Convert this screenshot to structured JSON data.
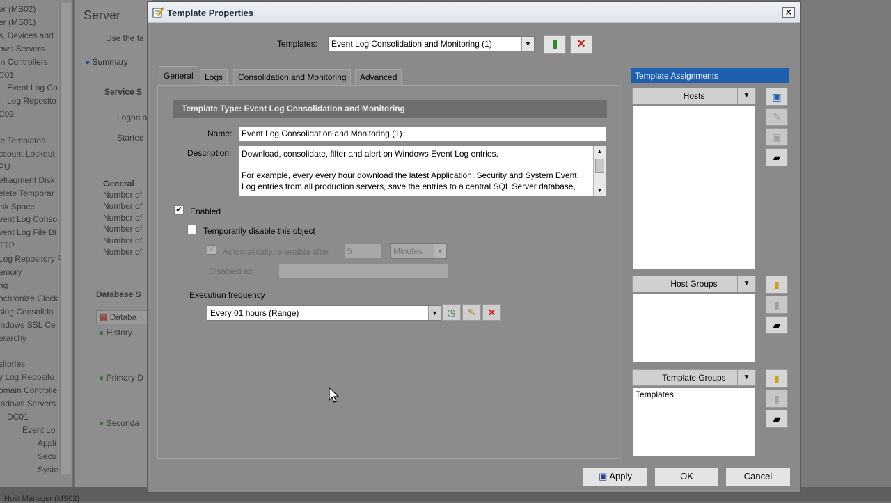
{
  "background": {
    "tree_items": [
      "er (MS02)",
      "er (MS01)",
      "s, Devices and",
      "ows Servers",
      "in Controllers",
      "C01",
      "Event Log Co",
      "Log Reposito",
      "C02",
      "",
      "le Templates",
      "ccount Lockout",
      "PU",
      "efragment Disk",
      "elete Temporar",
      "isk Space",
      "vent Log Conso",
      "vent Log File Bi",
      "TTP",
      "Log Repository F",
      "emory",
      "ng",
      "nchronize Clock",
      "slog Consolida",
      "indows SSL Ce",
      "erarchy",
      "",
      "sitories",
      "y Log Reposito",
      "omain Controlle",
      "indows Servers",
      "DC01",
      "Event Lo",
      "Appli",
      "Secu",
      "Syste"
    ],
    "main_title": "Server",
    "main_desc": "Use the ta",
    "main_tab": "Summary",
    "service_label": "Service S",
    "logon": "Logon a",
    "started": "Started",
    "general": "General",
    "number_of": [
      "Number of",
      "Number of",
      "Number of",
      "Number of",
      "Number of",
      "Number of"
    ],
    "database_label": "Database S",
    "db_column": "Databa",
    "db_rows": [
      "History",
      "Primary D",
      "Seconda"
    ],
    "bottom_text": "Host Manager (MS02)"
  },
  "dialog": {
    "title": "Template Properties",
    "templates_label": "Templates:",
    "templates_value": "Event Log Consolidation and Monitoring (1)",
    "tabs": [
      {
        "label": "General",
        "active": true
      },
      {
        "label": "Logs",
        "active": false
      },
      {
        "label": "Consolidation and Monitoring",
        "active": false
      },
      {
        "label": "Advanced",
        "active": false
      }
    ],
    "template_type_header": "Template Type: Event Log Consolidation and Monitoring",
    "name_label": "Name:",
    "name_value": "Event Log Consolidation and Monitoring (1)",
    "description_label": "Description:",
    "description_line1": "Download, consolidate, filter and alert on Windows Event Log entries.",
    "description_line2": "For example, every every hour download the latest Application, Security and System Event Log entries from all production servers, save the entries to a central SQL Server database,",
    "enabled_label": "Enabled",
    "enabled_checked": true,
    "temp_disable_label": "Temporarily disable this object",
    "temp_disable_checked": false,
    "auto_reenable_label": "Automatically re-enable after",
    "auto_reenable_checked": true,
    "reenable_value": "5",
    "reenable_unit": "Minutes",
    "disabled_at_label": "Disabled at:",
    "disabled_at_value": "",
    "exec_freq_label": "Execution frequency",
    "exec_freq_value": "Every 01 hours (Range)",
    "assignments_header": "Template Assignments",
    "hosts_label": "Hosts",
    "host_groups_label": "Host Groups",
    "template_groups_label": "Template Groups",
    "template_groups_items": [
      "Templates"
    ],
    "apply_label": "Apply",
    "ok_label": "OK",
    "cancel_label": "Cancel"
  },
  "colors": {
    "assignments_header": "#1f5fb0",
    "delete_red": "#d11a1a"
  }
}
